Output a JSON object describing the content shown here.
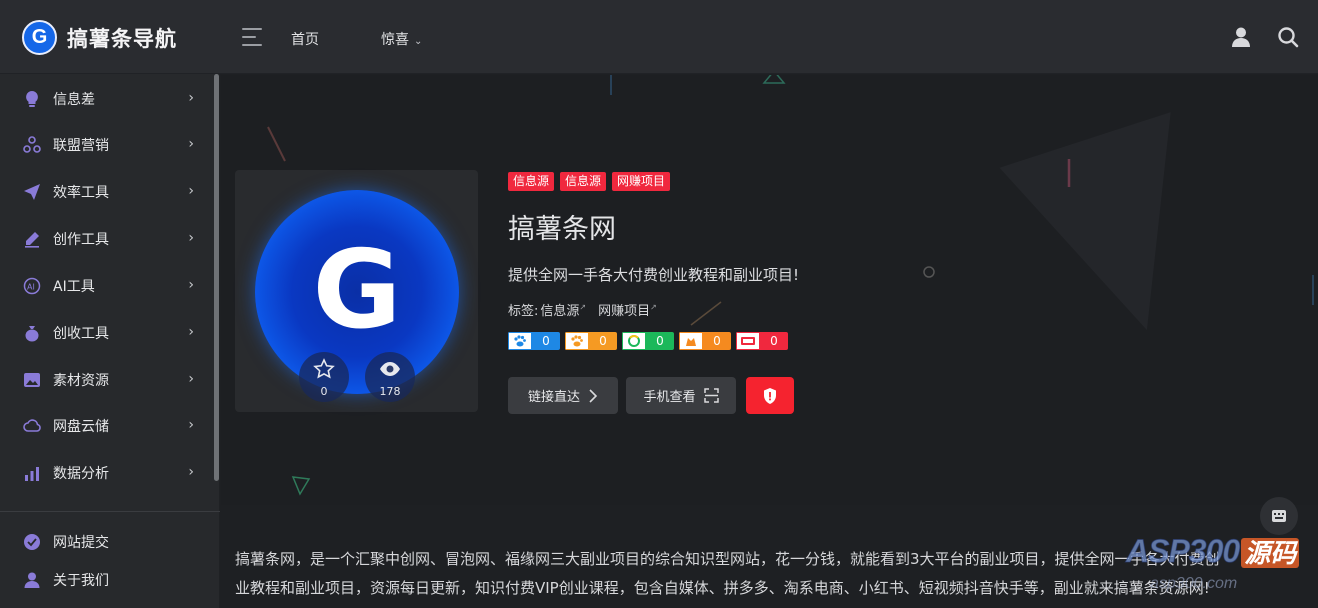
{
  "header": {
    "logo_letter": "G",
    "site_name": "搞薯条导航",
    "nav": [
      {
        "label": "首页"
      },
      {
        "label": "惊喜"
      }
    ]
  },
  "sidebar": {
    "items": [
      {
        "label": "信息差",
        "icon": "lightbulb-icon"
      },
      {
        "label": "联盟营销",
        "icon": "network-icon"
      },
      {
        "label": "效率工具",
        "icon": "paper-plane-icon"
      },
      {
        "label": "创作工具",
        "icon": "pencil-icon"
      },
      {
        "label": "AI工具",
        "icon": "ai-icon"
      },
      {
        "label": "创收工具",
        "icon": "money-bag-icon"
      },
      {
        "label": "素材资源",
        "icon": "image-icon"
      },
      {
        "label": "网盘云储",
        "icon": "cloud-icon"
      },
      {
        "label": "数据分析",
        "icon": "chart-icon"
      }
    ],
    "bottom": [
      {
        "label": "网站提交",
        "icon": "check-circle-icon"
      },
      {
        "label": "关于我们",
        "icon": "user-icon"
      }
    ]
  },
  "site": {
    "tags": [
      "信息源",
      "信息源",
      "网赚项目"
    ],
    "title": "搞薯条网",
    "description": "提供全网一手各大付费创业教程和副业项目!",
    "labels_prefix": "标签:",
    "labels": [
      "信息源",
      "网赚项目"
    ],
    "favorites": "0",
    "views": "178",
    "metrics": [
      {
        "name": "baidu",
        "value": "0",
        "color": "#1e88e5"
      },
      {
        "name": "baidu-mobile",
        "value": "0",
        "color": "#f59a23"
      },
      {
        "name": "360",
        "value": "0",
        "color": "#1cb85a"
      },
      {
        "name": "sogou",
        "value": "0",
        "color": "#f58a1f"
      },
      {
        "name": "toutiao",
        "value": "0",
        "color": "#f0283e"
      }
    ],
    "btn_visit": "链接直达",
    "btn_mobile": "手机查看"
  },
  "content": {
    "lines": [
      "搞薯条网，是一个汇聚中创网、冒泡网、福缘网三大副业项目的综合知识型网站，花一分钱，就能看到3大平台的副业项目，提供全网一手各大付费创",
      "业教程和副业项目，资源每日更新，知识付费VIP创业课程，包含自媒体、拼多多、淘系电商、小红书、短视频抖音快手等，副业就来搞薯条资源网!"
    ]
  },
  "watermark": {
    "brand": "ASP300",
    "suffix": "源码",
    "url": "asp300.com"
  }
}
